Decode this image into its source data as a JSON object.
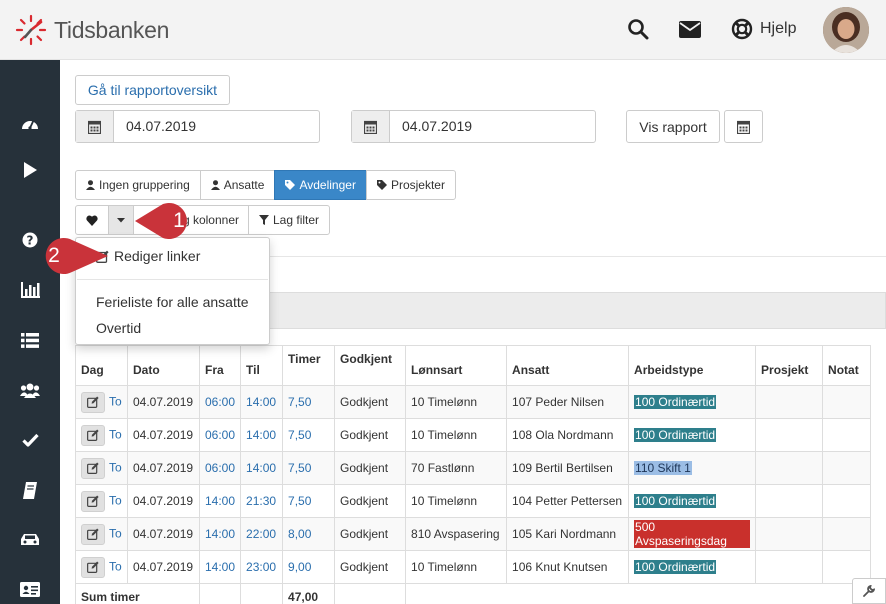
{
  "app": {
    "logo_text": "Tidsbanken",
    "help_label": "Hjelp"
  },
  "colors": {
    "sidebar": "#26313a",
    "accent": "#3a87c8",
    "callout": "#c9333a",
    "badge_ordinaer": "#2e7f8c",
    "badge_skift": "#9bbde5",
    "badge_avspasering": "#c9302c"
  },
  "sidebar": {
    "icons": [
      "dashboard-icon",
      "play-icon",
      "question-icon",
      "bar-chart-icon",
      "list-icon",
      "users-icon",
      "check-icon",
      "book-icon",
      "car-icon",
      "id-card-icon"
    ]
  },
  "toolbar": {
    "report_overview_label": "Gå til rapportoversikt",
    "date_from": "04.07.2019",
    "date_to": "04.07.2019",
    "show_report_label": "Vis rapport"
  },
  "grouping": {
    "items": [
      {
        "label": "Ingen gruppering",
        "icon": "user-icon"
      },
      {
        "label": "Ansatte",
        "icon": "user-icon"
      },
      {
        "label": "Avdelinger",
        "icon": "tag-icon"
      },
      {
        "label": "Prosjekter",
        "icon": "tag-icon"
      }
    ]
  },
  "actions": {
    "choose_columns_label": "Velg kolonner",
    "choose_columns_visible": "elg kolonner",
    "filter_label": "Lag filter"
  },
  "dropdown": {
    "edit_links_label": "Rediger linker",
    "items": [
      "Ferieliste for alle ansatte",
      "Overtid"
    ]
  },
  "callouts": [
    "1",
    "2"
  ],
  "table": {
    "headers": [
      "Dag",
      "Dato",
      "Fra",
      "Til",
      "Timer",
      "Godkjent",
      "Lønnsart",
      "Ansatt",
      "Arbeidstype",
      "Prosjekt",
      "Notat"
    ],
    "rows": [
      {
        "dag": "To",
        "dato": "04.07.2019",
        "fra": "06:00",
        "til": "14:00",
        "timer": "7,50",
        "godkjent": "Godkjent",
        "lonnsart": "10 Timelønn",
        "ansatt": "107 Peder Nilsen",
        "arbeidstype": "100 Ordinærtid"
      },
      {
        "dag": "To",
        "dato": "04.07.2019",
        "fra": "06:00",
        "til": "14:00",
        "timer": "7,50",
        "godkjent": "Godkjent",
        "lonnsart": "10 Timelønn",
        "ansatt": "108 Ola Nordmann",
        "arbeidstype": "100 Ordinærtid"
      },
      {
        "dag": "To",
        "dato": "04.07.2019",
        "fra": "06:00",
        "til": "14:00",
        "timer": "7,50",
        "godkjent": "Godkjent",
        "lonnsart": "70 Fastlønn",
        "ansatt": "109 Bertil Bertilsen",
        "arbeidstype": "110 Skift 1"
      },
      {
        "dag": "To",
        "dato": "04.07.2019",
        "fra": "14:00",
        "til": "21:30",
        "timer": "7,50",
        "godkjent": "Godkjent",
        "lonnsart": "10 Timelønn",
        "ansatt": "104 Petter Pettersen",
        "arbeidstype": "100 Ordinærtid"
      },
      {
        "dag": "To",
        "dato": "04.07.2019",
        "fra": "14:00",
        "til": "22:00",
        "timer": "8,00",
        "godkjent": "Godkjent",
        "lonnsart": "810 Avspasering",
        "ansatt": "105 Kari Nordmann",
        "arbeidstype": "500 Avspaseringsdag"
      },
      {
        "dag": "To",
        "dato": "04.07.2019",
        "fra": "14:00",
        "til": "23:00",
        "timer": "9,00",
        "godkjent": "Godkjent",
        "lonnsart": "10 Timelønn",
        "ansatt": "106 Knut Knutsen",
        "arbeidstype": "100 Ordinærtid"
      }
    ],
    "sum_label": "Sum timer",
    "sum_value": "47,00"
  }
}
